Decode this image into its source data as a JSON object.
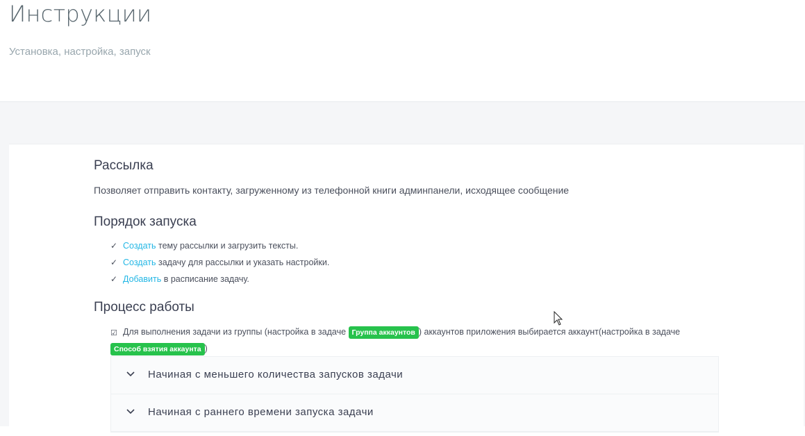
{
  "header": {
    "title": "Инструкции",
    "subtitle": "Установка, настройка, запуск"
  },
  "section_mailing": {
    "title": "Рассылка",
    "description": "Позволяет отправить контакту, загруженному из телефонной книги админпанели, исходящее сообщение"
  },
  "section_launch": {
    "title": "Порядок запуска",
    "steps": [
      {
        "link": "Создать",
        "text": " тему рассылки и загрузить тексты."
      },
      {
        "link": "Создать",
        "text": " задачу для рассылки и указать настройки."
      },
      {
        "link": "Добавить",
        "text": " в расписание задачу."
      }
    ]
  },
  "section_process": {
    "title": "Процесс работы",
    "text_1": "Для выполнения задачи из группы (настройка в задаче ",
    "badge_1": "Группа аккаунтов",
    "text_2": ") аккаунтов приложения выбирается аккаунт(настройка в задаче ",
    "badge_2": "Способ взятия аккаунта",
    "text_3": ")"
  },
  "accordion": {
    "items": [
      {
        "label": "Начиная с меньшего количества запусков задачи"
      },
      {
        "label": "Начиная с раннего времени запуска задачи"
      }
    ]
  },
  "colors": {
    "link": "#23b7e5",
    "badge": "#27c24c",
    "background": "#f5f6f8"
  },
  "icons": {
    "step": "check-icon",
    "process": "checkbox-checked-icon",
    "accordion": "chevron-down-icon",
    "pointer": "mouse-cursor-icon"
  }
}
